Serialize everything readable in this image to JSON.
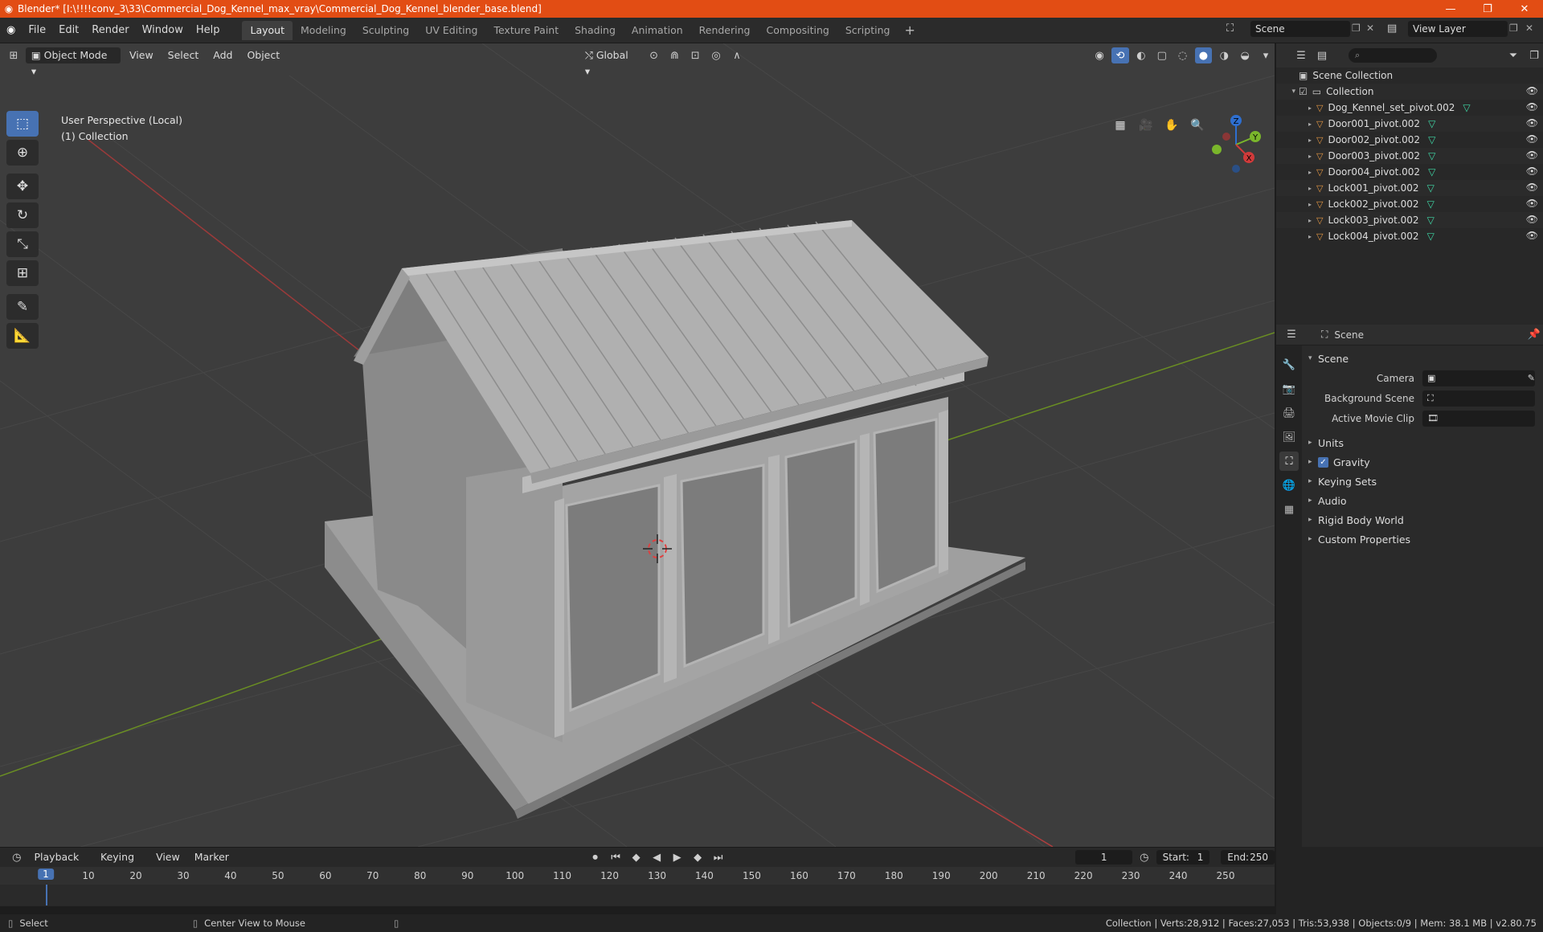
{
  "window": {
    "title": "Blender* [I:\\!!!!conv_3\\33\\Commercial_Dog_Kennel_max_vray\\Commercial_Dog_Kennel_blender_base.blend]",
    "logo": "blender-logo",
    "accent": "#e24d14"
  },
  "menu": {
    "items": [
      "File",
      "Edit",
      "Render",
      "Window",
      "Help"
    ]
  },
  "workspaces": {
    "tabs": [
      "Layout",
      "Modeling",
      "Sculpting",
      "UV Editing",
      "Texture Paint",
      "Shading",
      "Animation",
      "Rendering",
      "Compositing",
      "Scripting"
    ],
    "active": "Layout"
  },
  "scene_selector": {
    "value": "Scene"
  },
  "view_layer": {
    "value": "View Layer"
  },
  "viewport": {
    "mode": "Object Mode",
    "menus": [
      "View",
      "Select",
      "Add",
      "Object"
    ],
    "transform_orientation": "Global",
    "info_line1": "User Perspective (Local)",
    "info_line2": "(1) Collection",
    "background": "#3d3d3d"
  },
  "gizmo": {
    "z": "Z",
    "y": "Y",
    "x": "X"
  },
  "outliner": {
    "search_placeholder": "",
    "root": "Scene Collection",
    "collection": "Collection",
    "objects": [
      "Dog_Kennel_set_pivot.002",
      "Door001_pivot.002",
      "Door002_pivot.002",
      "Door003_pivot.002",
      "Door004_pivot.002",
      "Lock001_pivot.002",
      "Lock002_pivot.002",
      "Lock003_pivot.002",
      "Lock004_pivot.002"
    ]
  },
  "properties": {
    "context": "Scene",
    "panel_title": "Scene",
    "camera_label": "Camera",
    "background_scene_label": "Background Scene",
    "active_movie_clip_label": "Active Movie Clip",
    "sections": [
      "Units",
      "Gravity",
      "Keying Sets",
      "Audio",
      "Rigid Body World",
      "Custom Properties"
    ]
  },
  "timeline": {
    "menus": [
      "Playback",
      "Keying",
      "View",
      "Marker"
    ],
    "current_frame": "1",
    "start_label": "Start:",
    "start": "1",
    "end_label": "End:",
    "end": "250",
    "ruler": [
      "1",
      "10",
      "20",
      "30",
      "40",
      "50",
      "60",
      "70",
      "80",
      "90",
      "100",
      "110",
      "120",
      "130",
      "140",
      "150",
      "160",
      "170",
      "180",
      "190",
      "200",
      "210",
      "220",
      "230",
      "240",
      "250"
    ]
  },
  "status": {
    "select": "Select",
    "center_view": "Center View to Mouse",
    "stats": "Collection | Verts:28,912 | Faces:27,053 | Tris:53,938 | Objects:0/9 | Mem: 38.1 MB | v2.80.75"
  }
}
